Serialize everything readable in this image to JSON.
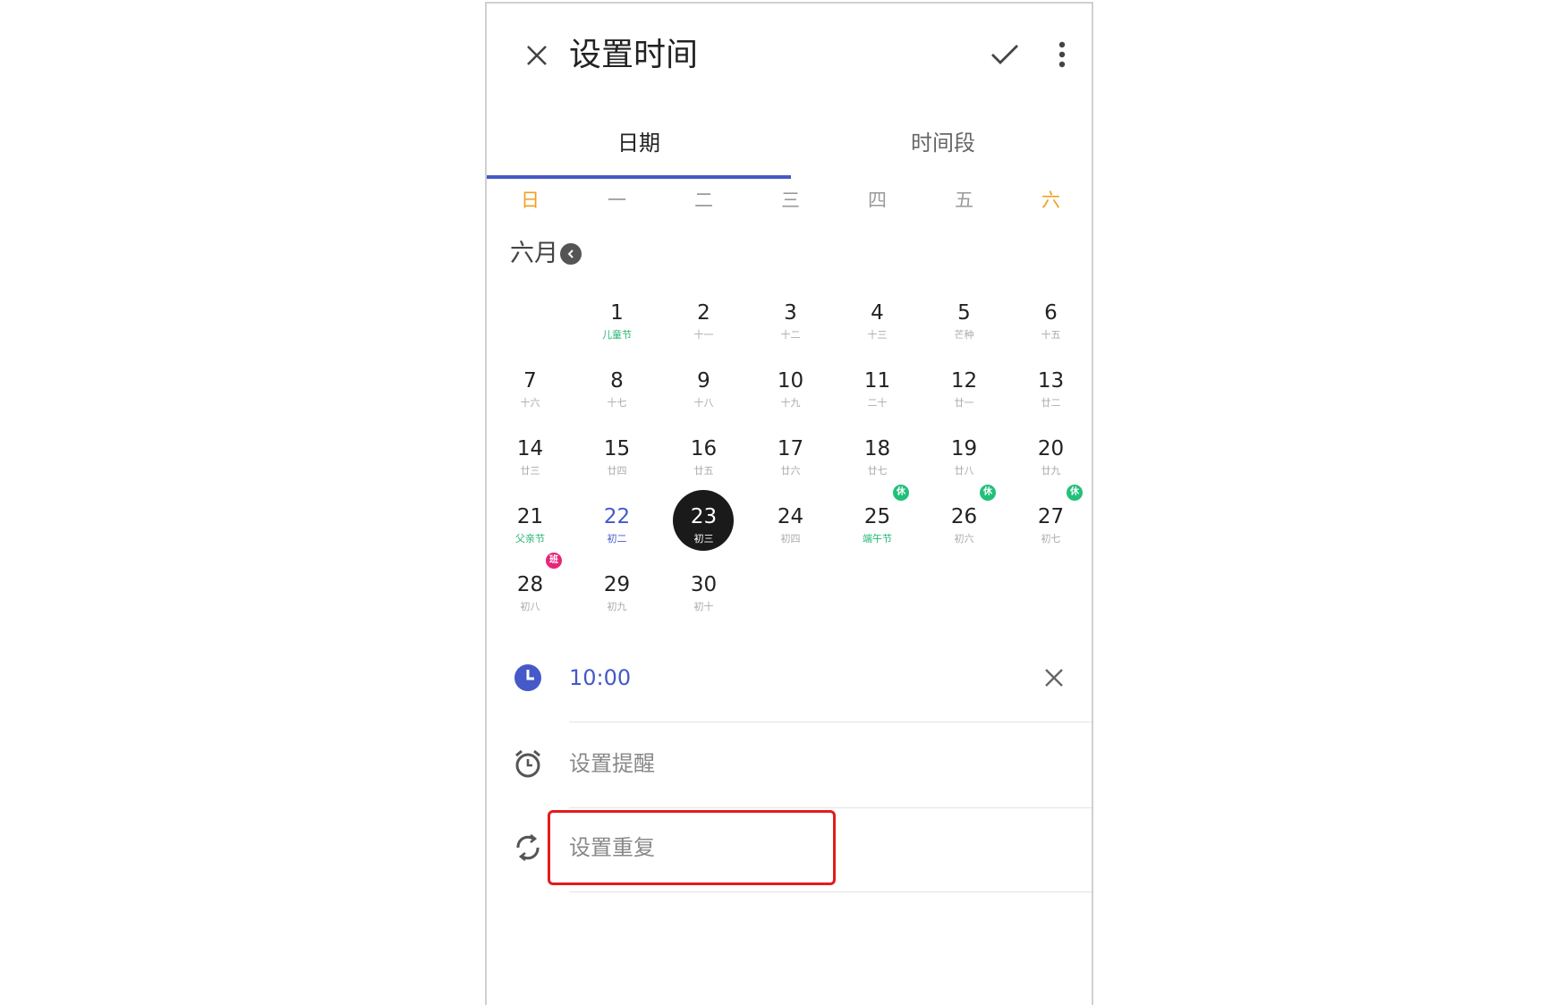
{
  "topbar": {
    "title": "设置时间",
    "close_icon": "close-icon",
    "confirm_icon": "check-icon",
    "more_icon": "more-vert-icon"
  },
  "tabs": [
    {
      "label": "日期",
      "active": true
    },
    {
      "label": "时间段",
      "active": false
    }
  ],
  "weekdays": [
    "日",
    "一",
    "二",
    "三",
    "四",
    "五",
    "六"
  ],
  "month": {
    "label": "六月",
    "prev_icon": "chevron-left-icon"
  },
  "days": [
    {
      "num": "1",
      "sub": "儿童节",
      "holiday": true
    },
    {
      "num": "2",
      "sub": "十一"
    },
    {
      "num": "3",
      "sub": "十二"
    },
    {
      "num": "4",
      "sub": "十三"
    },
    {
      "num": "5",
      "sub": "芒种"
    },
    {
      "num": "6",
      "sub": "十五"
    },
    {
      "num": "7",
      "sub": "十六"
    },
    {
      "num": "8",
      "sub": "十七"
    },
    {
      "num": "9",
      "sub": "十八"
    },
    {
      "num": "10",
      "sub": "十九"
    },
    {
      "num": "11",
      "sub": "二十"
    },
    {
      "num": "12",
      "sub": "廿一"
    },
    {
      "num": "13",
      "sub": "廿二"
    },
    {
      "num": "14",
      "sub": "廿三"
    },
    {
      "num": "15",
      "sub": "廿四"
    },
    {
      "num": "16",
      "sub": "廿五"
    },
    {
      "num": "17",
      "sub": "廿六"
    },
    {
      "num": "18",
      "sub": "廿七"
    },
    {
      "num": "19",
      "sub": "廿八"
    },
    {
      "num": "20",
      "sub": "廿九"
    },
    {
      "num": "21",
      "sub": "父亲节",
      "holiday": true
    },
    {
      "num": "22",
      "sub": "初二",
      "today": true
    },
    {
      "num": "23",
      "sub": "初三",
      "selected": true
    },
    {
      "num": "24",
      "sub": "初四"
    },
    {
      "num": "25",
      "sub": "端午节",
      "holiday": true,
      "badge": "休"
    },
    {
      "num": "26",
      "sub": "初六",
      "badge": "休"
    },
    {
      "num": "27",
      "sub": "初七",
      "badge": "休"
    },
    {
      "num": "28",
      "sub": "初八",
      "badge": "班"
    },
    {
      "num": "29",
      "sub": "初九"
    },
    {
      "num": "30",
      "sub": "初十"
    }
  ],
  "rows": {
    "time": {
      "value": "10:00",
      "icon": "clock-icon",
      "clear_icon": "close-icon"
    },
    "reminder": {
      "label": "设置提醒",
      "icon": "alarm-icon"
    },
    "repeat": {
      "label": "设置重复",
      "icon": "repeat-icon"
    }
  },
  "colors": {
    "accent": "#4559c8",
    "weekend": "#f0a020",
    "holiday": "#22b673",
    "rest_badge": "#22c07a",
    "work_badge": "#e8257a",
    "highlight": "#e31c1c"
  }
}
